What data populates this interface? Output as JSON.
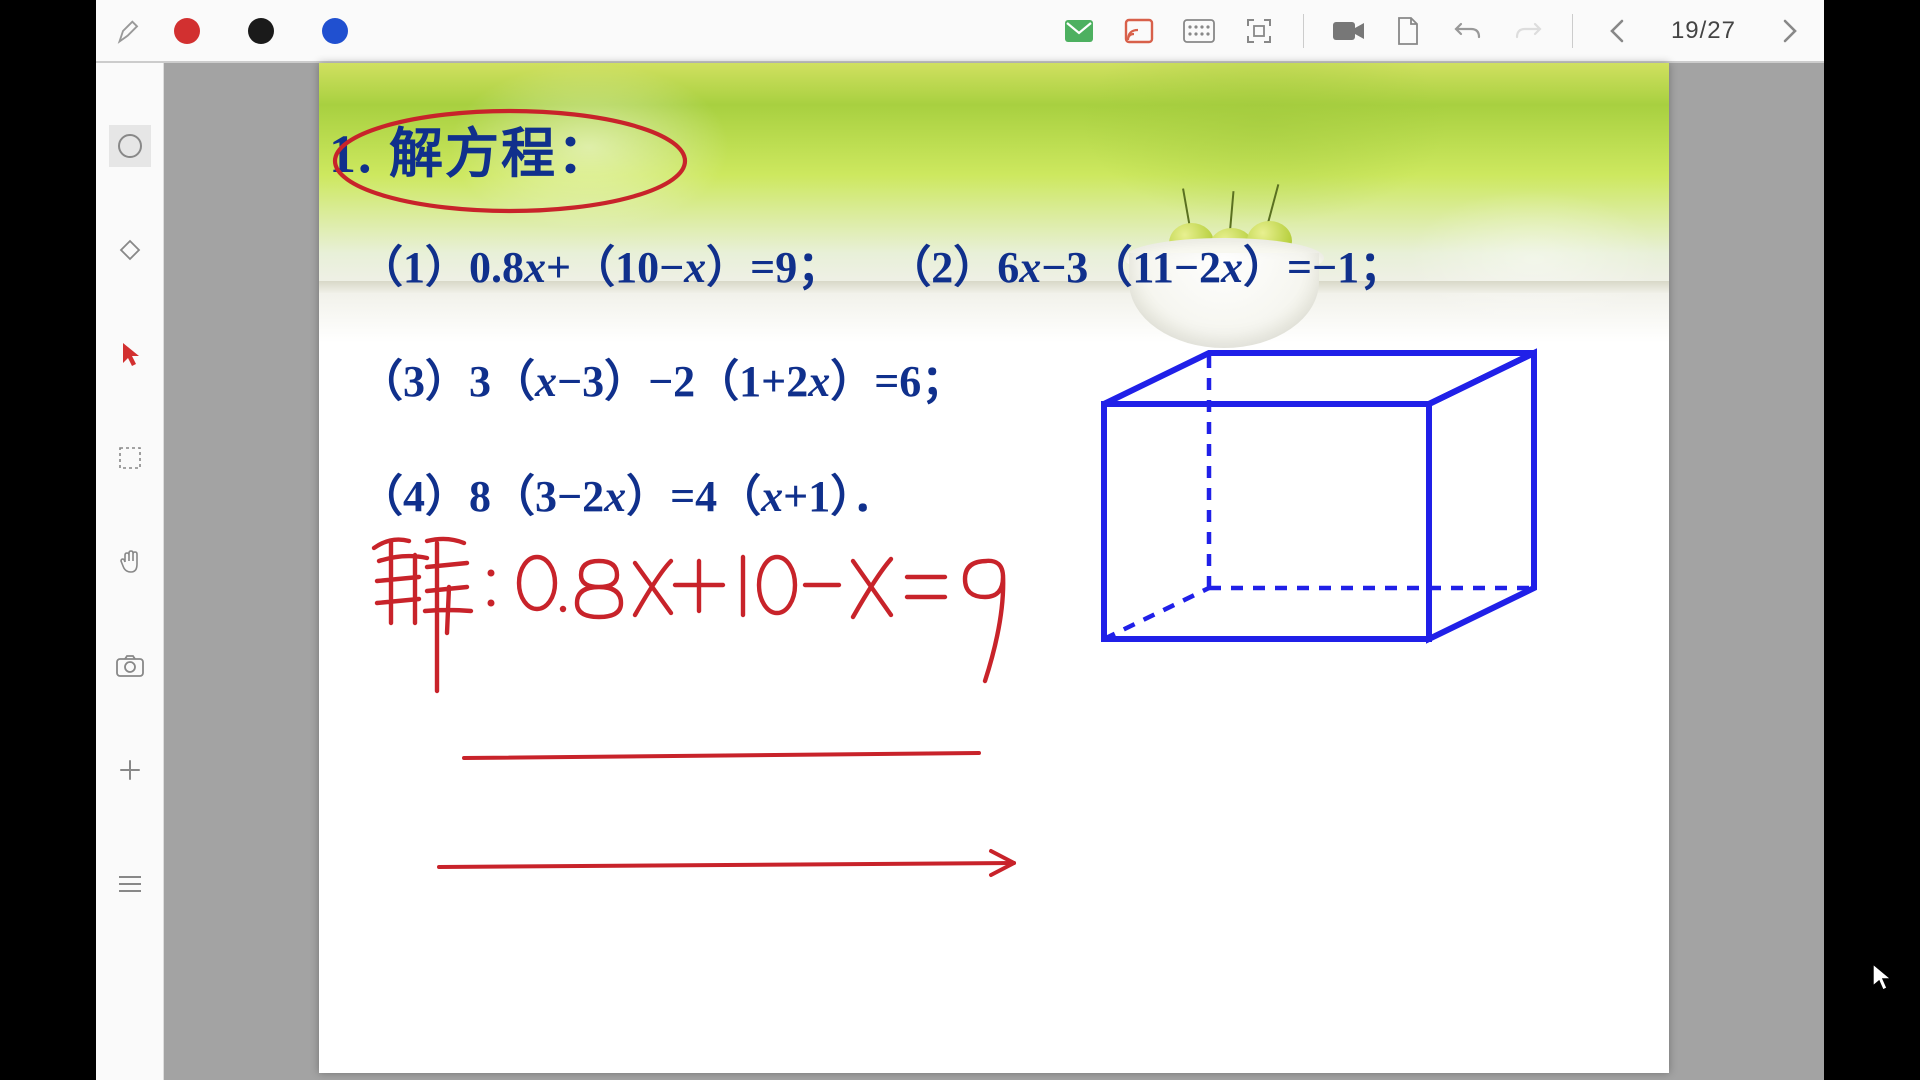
{
  "toolbar": {
    "colors": [
      {
        "name": "red",
        "value": "#d23030"
      },
      {
        "name": "black",
        "value": "#1a1a1a"
      },
      {
        "name": "blue",
        "value": "#2050d0"
      }
    ],
    "page_counter": "19/27"
  },
  "sidebar": {
    "tools": [
      {
        "name": "shape-circle",
        "active": true
      },
      {
        "name": "eraser",
        "active": false
      },
      {
        "name": "pointer",
        "active": false
      },
      {
        "name": "select",
        "active": false
      },
      {
        "name": "hand",
        "active": false
      },
      {
        "name": "camera",
        "active": false
      },
      {
        "name": "add",
        "active": false
      },
      {
        "name": "list",
        "active": false
      }
    ]
  },
  "slide": {
    "heading": "1. 解方程：",
    "equations": {
      "e1_label": "（1）",
      "e1_body": "0.8x+（10−x）=9；",
      "e2_label": "（2）",
      "e2_body": "6x−3（11−2x）=−1；",
      "e3_label": "（3）",
      "e3_body": "3（x−3）−2（1+2x）=6；",
      "e4_label": "（4）",
      "e4_body": "8（3−2x）=4（x+1）．"
    },
    "handwriting": {
      "label": "解：",
      "equation": "0.8x+10−x=9"
    },
    "shapes": {
      "cuboid": {
        "stroke": "#2020e8"
      }
    }
  }
}
